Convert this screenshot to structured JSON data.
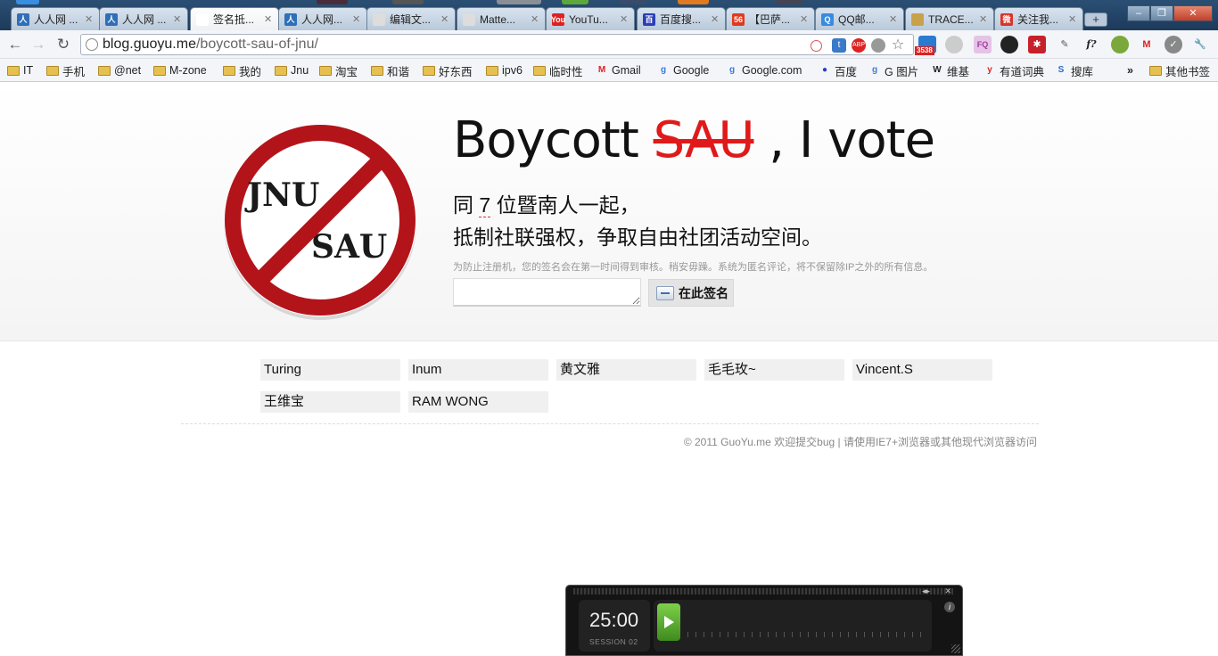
{
  "browser": {
    "tabs": [
      {
        "title": "人人网 ...",
        "fav_color": "#2f6fb7",
        "fav_glyph": "人"
      },
      {
        "title": "人人网 ...",
        "fav_color": "#2f6fb7",
        "fav_glyph": "人"
      },
      {
        "title": "签名抵...",
        "fav_color": "#ffffff",
        "fav_glyph": "",
        "active": true
      },
      {
        "title": "人人网...",
        "fav_color": "#2f6fb7",
        "fav_glyph": "人"
      },
      {
        "title": "编辑文...",
        "fav_color": "#dddddd",
        "fav_glyph": ""
      },
      {
        "title": "Matte...",
        "fav_color": "#dddddd",
        "fav_glyph": ""
      },
      {
        "title": "YouTu...",
        "fav_color": "#d22",
        "fav_glyph": "You"
      },
      {
        "title": "百度搜...",
        "fav_color": "#2b3fb8",
        "fav_glyph": "百"
      },
      {
        "title": "【巴萨...",
        "fav_color": "#e03a1e",
        "fav_glyph": "56"
      },
      {
        "title": "QQ邮...",
        "fav_color": "#3a8be0",
        "fav_glyph": "Q"
      },
      {
        "title": "TRACE...",
        "fav_color": "#c8a24a",
        "fav_glyph": ""
      },
      {
        "title": "关注我...",
        "fav_color": "#d8352a",
        "fav_glyph": "微"
      }
    ],
    "new_tab": "+",
    "window_controls": [
      "–",
      "❐",
      "✕"
    ],
    "url_host": "blog.guoyu.me",
    "url_path": "/boycott-sau-of-jnu/",
    "extension_badge": "3538",
    "bookmarks": [
      {
        "label": "IT",
        "icon": "folder"
      },
      {
        "label": "手机",
        "icon": "folder"
      },
      {
        "label": "@net",
        "icon": "folder"
      },
      {
        "label": "M-zone",
        "icon": "folder"
      },
      {
        "label": "我的",
        "icon": "folder"
      },
      {
        "label": "Jnu",
        "icon": "folder"
      },
      {
        "label": "淘宝",
        "icon": "folder"
      },
      {
        "label": "和谐",
        "icon": "folder"
      },
      {
        "label": "好东西",
        "icon": "folder"
      },
      {
        "label": "ipv6",
        "icon": "folder"
      },
      {
        "label": "临时性",
        "icon": "folder"
      },
      {
        "label": "Gmail",
        "icon": "gmail"
      },
      {
        "label": "Google",
        "icon": "google"
      },
      {
        "label": "Google.com",
        "icon": "google"
      },
      {
        "label": "百度",
        "icon": "baidu"
      },
      {
        "label": "G 图片",
        "icon": "google"
      },
      {
        "label": "维基",
        "icon": "wiki"
      },
      {
        "label": "有道词典",
        "icon": "youdao"
      },
      {
        "label": "搜库",
        "icon": "soku"
      }
    ],
    "bookmarks_overflow": "»",
    "other_bookmarks": "其他书签"
  },
  "page": {
    "logo_top_text": "JNU",
    "logo_bottom_text": "SAU",
    "headline_pre": "Boycott ",
    "headline_strike": "SAU",
    "headline_post": " , I vote",
    "sub1_pre": "同 ",
    "sub1_count": "7",
    "sub1_post": " 位暨南人一起，",
    "sub2": "抵制社联强权，争取自由社团活动空间。",
    "note": "为防止注册机，您的签名会在第一时间得到审核。稍安毋躁。系统为匿名评论，将不保留除IP之外的所有信息。",
    "sign_input_value": "",
    "sign_button": "在此签名",
    "signers": [
      "Turing",
      "Inum",
      "黄文雅",
      "毛毛玫~",
      "Vincent.S",
      "王维宝",
      "RAM WONG"
    ],
    "footer": "© 2011 GuoYu.me 欢迎提交bug | 请使用IE7+浏览器或其他现代浏览器访问"
  },
  "timer": {
    "time": "25:00",
    "session": "SESSION 02",
    "info": "i"
  },
  "colors": {
    "accent_red": "#e01a1a",
    "sign_stop_red": "#b3141a"
  }
}
